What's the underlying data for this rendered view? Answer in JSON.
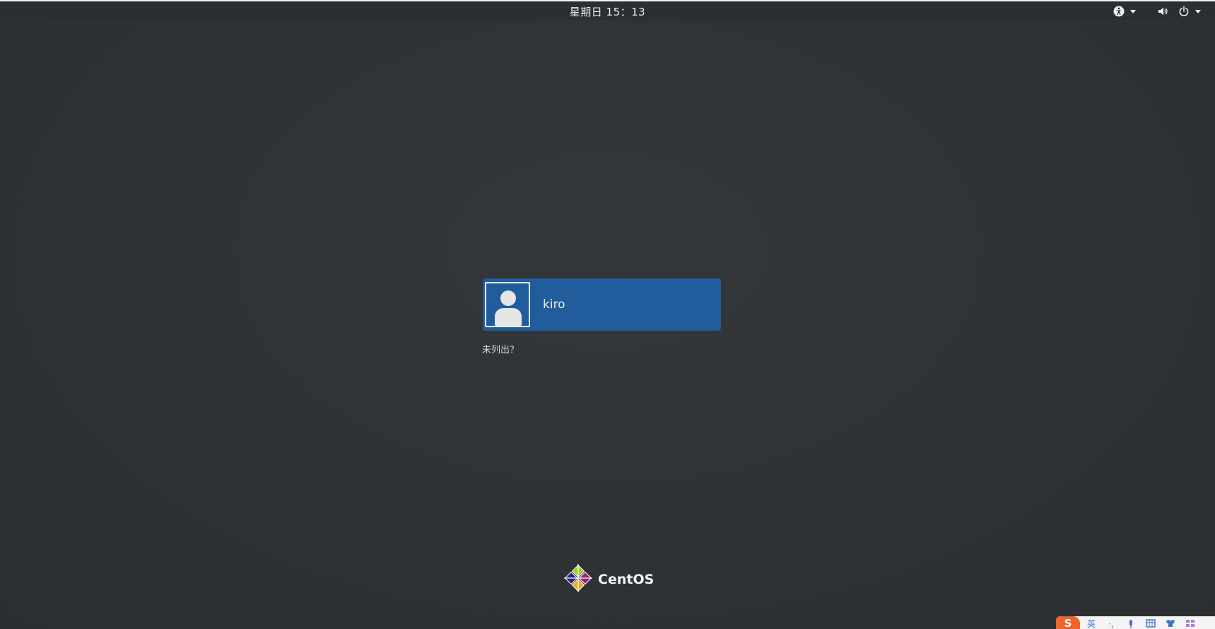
{
  "topbar": {
    "clock": "星期日 15：13",
    "icons": [
      "accessibility-icon",
      "volume-icon",
      "power-icon"
    ]
  },
  "login": {
    "user_name": "kiro",
    "not_listed": "未列出？"
  },
  "branding": {
    "logo_text": "CentOS"
  },
  "ime_toolbar": {
    "logo_glyph": "S",
    "mode_label": "英",
    "items": [
      "punctuation-icon",
      "microphone-icon",
      "keyboard-icon",
      "skin-icon",
      "grid-icon"
    ]
  },
  "colors": {
    "background": "#2e3235",
    "user_card": "#215d9c",
    "text": "#eeeeec",
    "ime_accent": "#f0642b"
  }
}
